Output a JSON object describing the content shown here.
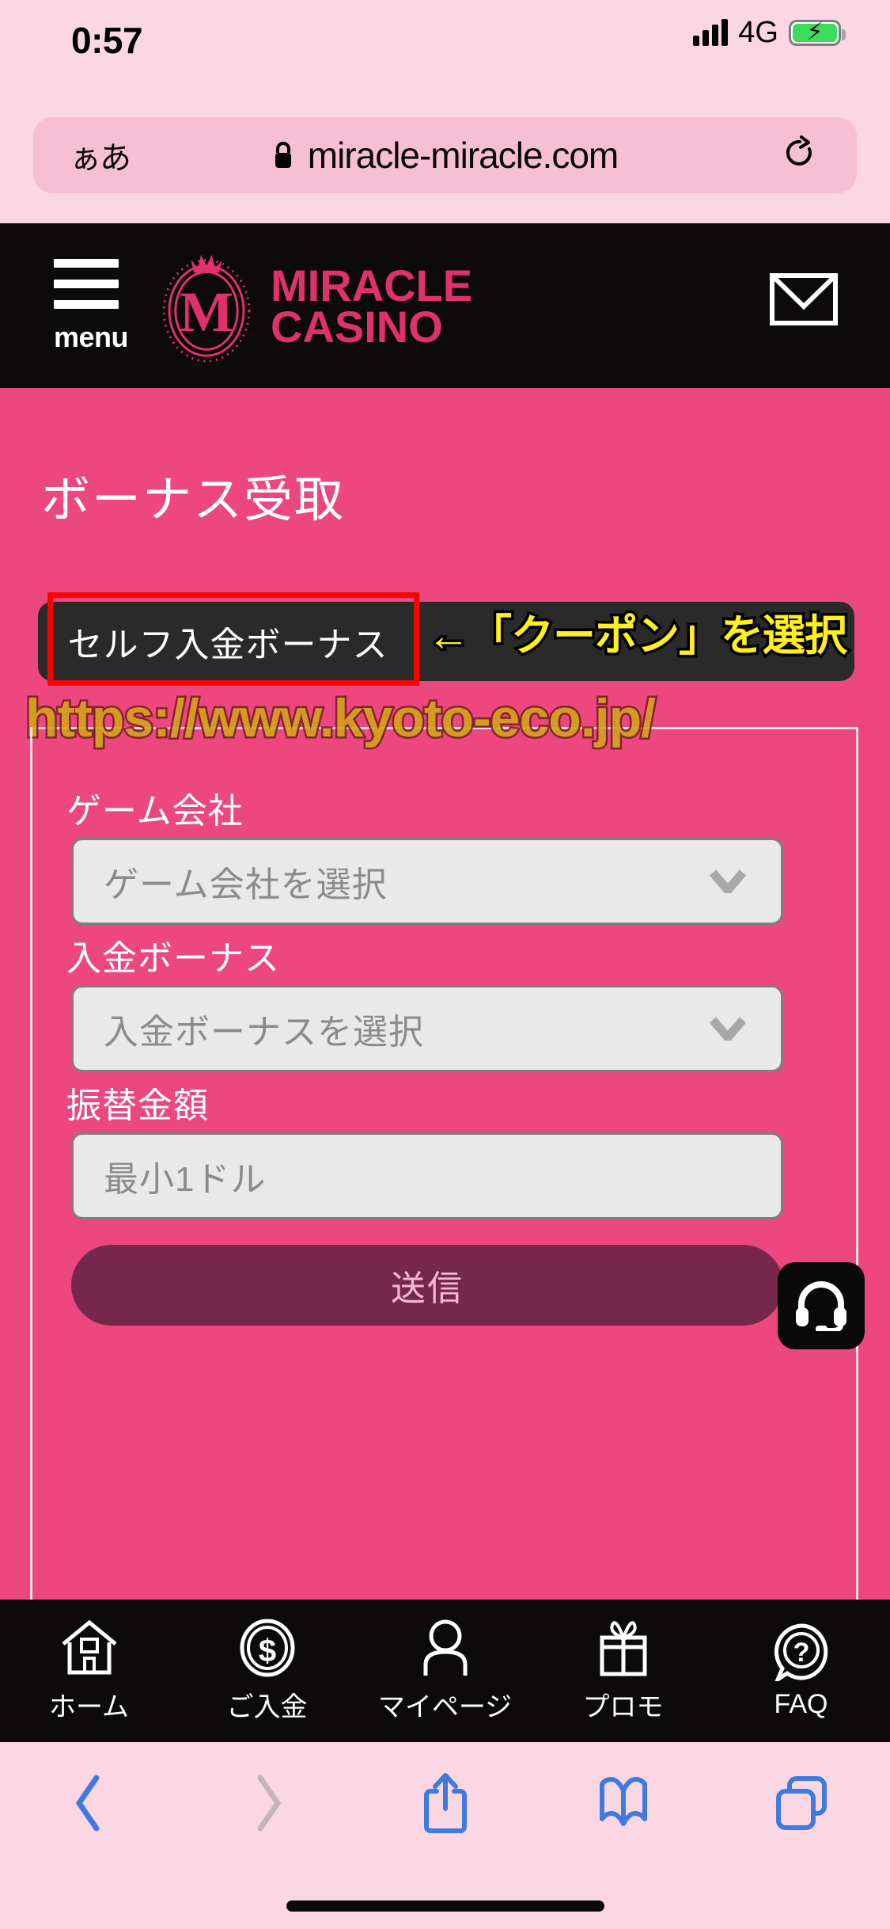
{
  "status_bar": {
    "time": "0:57",
    "network": "4G",
    "signal_icon": "signal-bars-icon",
    "battery_icon": "battery-charging-icon",
    "battery_color": "#3ddc5b"
  },
  "browser": {
    "text_size_button": "ぁあ",
    "lock_icon": "lock-icon",
    "url": "miracle-miracle.com",
    "reload_icon": "reload-icon",
    "toolbar": {
      "back_icon": "chevron-left-icon",
      "forward_icon": "chevron-right-icon",
      "share_icon": "share-icon",
      "bookmarks_icon": "book-icon",
      "tabs_icon": "tabs-icon",
      "accent_color": "#3f7ae0",
      "disabled_color": "#c6b4bc"
    }
  },
  "site_header": {
    "menu_label": "menu",
    "menu_icon": "hamburger-icon",
    "logo_line1": "MIRACLE",
    "logo_line2": "CASINO",
    "logo_color": "#e0316f",
    "mail_icon": "envelope-icon",
    "background": "#0c0a0a"
  },
  "page": {
    "title": "ボーナス受取",
    "background": "#ec477e",
    "tabs": [
      {
        "label": "セルフ入金ボーナス",
        "active": true,
        "highlighted": true
      }
    ],
    "annotation": {
      "text": "←「クーポン」を選択",
      "fill_color": "#ffef1a",
      "stroke_color": "#000000"
    },
    "highlight_box_color": "#fe0000",
    "watermark": {
      "text": "https://www.kyoto-eco.jp/",
      "fill_color": "#d2a21b",
      "stroke_color": "#7d1f29"
    },
    "form": {
      "fields": [
        {
          "label": "ゲーム会社",
          "type": "select",
          "value": "ゲーム会社を選択",
          "is_placeholder": true,
          "chevron_icon": "chevron-down-icon"
        },
        {
          "label": "入金ボーナス",
          "type": "select",
          "value": "入金ボーナスを選択",
          "is_placeholder": true,
          "chevron_icon": "chevron-down-icon"
        },
        {
          "label": "振替金額",
          "type": "text",
          "value": "",
          "placeholder": "最小1ドル",
          "is_placeholder": true
        }
      ],
      "submit_label": "送信",
      "submit_bg": "#75284b",
      "submit_text_color": "#f6b8cf"
    },
    "support_widget": {
      "icon": "headset-icon",
      "label": ""
    }
  },
  "bottom_nav": {
    "items": [
      {
        "label": "ホーム",
        "icon": "home-icon"
      },
      {
        "label": "ご入金",
        "icon": "dollar-coin-icon"
      },
      {
        "label": "マイページ",
        "icon": "person-icon"
      },
      {
        "label": "プロモ",
        "icon": "gift-icon"
      },
      {
        "label": "FAQ",
        "icon": "question-bubble-icon"
      }
    ]
  }
}
